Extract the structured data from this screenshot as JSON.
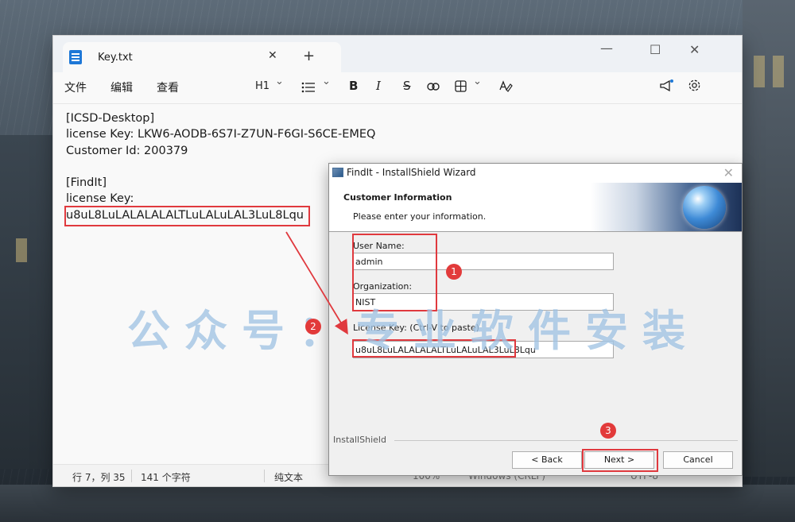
{
  "notepad": {
    "tab_title": "Key.txt",
    "tab_close": "✕",
    "new_tab": "+",
    "window_controls": {
      "minimize": "—",
      "maximize": "☐",
      "close": "✕"
    },
    "menu": {
      "file": "文件",
      "edit": "编辑",
      "view": "查看"
    },
    "toolbar": {
      "heading": "H1",
      "chevron": "⌄",
      "bold": "B",
      "italic": "I",
      "strike": "S"
    },
    "lines": [
      "[ICSD-Desktop]",
      "license Key: LKW6-AODB-6S7I-Z7UN-F6GI-S6CE-EMEQ",
      "Customer Id: 200379",
      "",
      "[FindIt]",
      "license Key:",
      "u8uL8LuLALALALALTLuLALuLAL3LuL8Lqu"
    ],
    "status": {
      "position": "行 7，列 35",
      "char_count": "141 个字符",
      "format": "纯文本",
      "zoom": "100%",
      "line_ending": "Windows (CRLF)",
      "encoding": "UTF-8"
    }
  },
  "dialog": {
    "title": "FindIt - InstallShield Wizard",
    "close": "✕",
    "heading": "Customer Information",
    "subheading": "Please enter your information.",
    "user_name_label": "User Name:",
    "user_name_value": "admin",
    "organization_label": "Organization:",
    "organization_value": "NIST",
    "license_label": "License Key: (Ctrl-V to paste)",
    "license_value": "u8uL8LuLALALALALTLuLALuLAL3LuL8Lqu",
    "footer_label": "InstallShield",
    "buttons": {
      "back": "< Back",
      "next": "Next >",
      "cancel": "Cancel"
    }
  },
  "annotations": {
    "step1": "1",
    "step2": "2",
    "step3": "3",
    "watermark": "公众号：专业软件安装",
    "accent_color": "#e0393e"
  }
}
